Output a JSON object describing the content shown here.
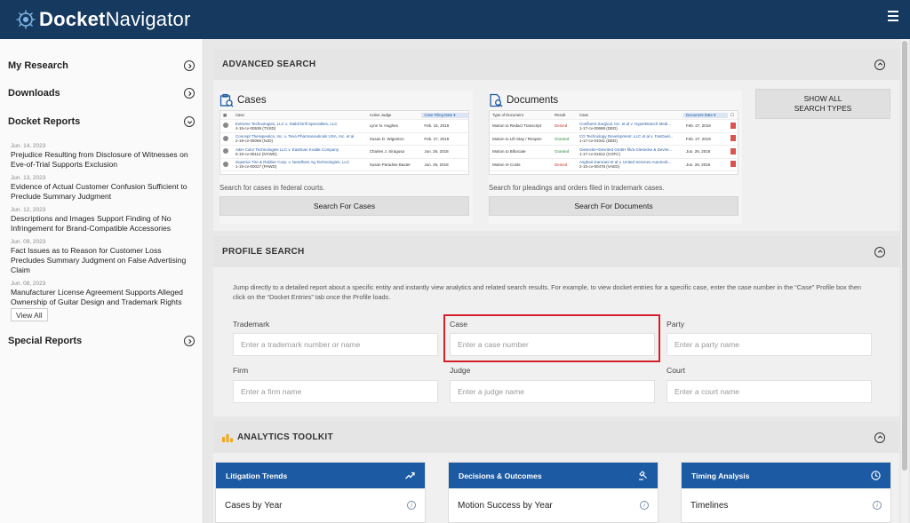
{
  "brand": {
    "bold": "Docket",
    "rest": "Navigator"
  },
  "sidebar": {
    "my_research": "My Research",
    "downloads": "Downloads",
    "docket_reports": "Docket Reports",
    "reports": [
      {
        "date": "Jun. 14, 2023",
        "title": "Prejudice Resulting from Disclosure of Witnesses on Eve-of-Trial Supports Exclusion"
      },
      {
        "date": "Jun. 13, 2023",
        "title": "Evidence of Actual Customer Confusion Sufficient to Preclude Summary Judgment"
      },
      {
        "date": "Jun. 12, 2023",
        "title": "Descriptions and Images Support Finding of No Infringement for Brand-Compatible Accessories"
      },
      {
        "date": "Jun. 09, 2023",
        "title": "Fact Issues as to Reason for Customer Loss Precludes Summary Judgment on False Advertising Claim"
      },
      {
        "date": "Jun. 08, 2023",
        "title": "Manufacturer License Agreement Supports Alleged Ownership of Guitar Design and Trademark Rights"
      }
    ],
    "view_all": "View All",
    "special_reports": "Special Reports"
  },
  "advanced": {
    "title": "ADVANCED SEARCH",
    "cases": {
      "title": "Cases",
      "columns": [
        "Case",
        "Active Judge",
        "Case Filing Date"
      ],
      "rows": [
        {
          "case": "Extreme Technologies, LLC v. Stabil Drill Specialties, LLC",
          "num": "4-15-cv-00539 (TXSD)",
          "judge": "Lynn N. Hughes",
          "date": "Feb. 15, 2018"
        },
        {
          "case": "Concept Therapeutics, Inc. v. Teva Pharmaceuticals USA, Inc. et al",
          "num": "2-19-cv-05068 (NJD)",
          "judge": "Susan D. Wigenton",
          "date": "Feb. 27, 2019"
        },
        {
          "case": "A&H Color Technologies LLC v. Eastman Kodak Company",
          "num": "6-19-cv-06112 (NYWD)",
          "judge": "Charles J. Siragusa",
          "date": "Jun. 26, 2018"
        },
        {
          "case": "Superior Tire & Rubber Corp. v. Needham Ag Technologies, LLC",
          "num": "1-19-cv-00027 (PAWD)",
          "judge": "Susan Paradise Baxter",
          "date": "Jun. 26, 2018"
        }
      ],
      "desc": "Search for cases in federal courts.",
      "button": "Search For Cases"
    },
    "documents": {
      "title": "Documents",
      "columns": [
        "Type of Document",
        "Result",
        "Case",
        "Document Date"
      ],
      "rows": [
        {
          "type": "Motion to Redact Transcript",
          "result": "Denied",
          "case": "Confluent Surgical, Inc. et al v. HyperBranch Medi...",
          "num": "1-17-cv-00688 (DED)",
          "date": "Feb. 27, 2019"
        },
        {
          "type": "Motion to Lift Stay / Reopen",
          "result": "Granted",
          "case": "CG Technology Development, LLC et al v. FanDuel...",
          "num": "1-17-cv-01041 (DED)",
          "date": "Feb. 27, 2019"
        },
        {
          "type": "Motion to Bifurcate",
          "result": "Granted",
          "case": "Giesecke+Devrient GmbH f/k/a Giesecke & Devrie...",
          "num": "1-17-cv-01812 (COFC)",
          "date": "Jun. 26, 2018"
        },
        {
          "type": "Motion re Costs",
          "result": "Denied",
          "case": "Asghari-Kamrani et al v. United Services Automob...",
          "num": "2-15-cv-00478 (VAED)",
          "date": "Jun. 26, 2018"
        }
      ],
      "desc": "Search for pleadings and orders filed in trademark cases.",
      "button": "Search For Documents"
    },
    "show_all": "SHOW ALL SEARCH TYPES"
  },
  "profile": {
    "title": "PROFILE SEARCH",
    "hint": "Jump directly to a detailed report about a specific entity and instantly view analytics and related search results. For example, to view docket entries for a specific case, enter the case number in the “Case” Profile box then click on the “Docket Entries” tab once the Profile loads.",
    "fields": {
      "trademark": {
        "label": "Trademark",
        "placeholder": "Enter a trademark number or name"
      },
      "case": {
        "label": "Case",
        "placeholder": "Enter a case number"
      },
      "party": {
        "label": "Party",
        "placeholder": "Enter a party name"
      },
      "firm": {
        "label": "Firm",
        "placeholder": "Enter a firm name"
      },
      "judge": {
        "label": "Judge",
        "placeholder": "Enter a judge name"
      },
      "court": {
        "label": "Court",
        "placeholder": "Enter a court name"
      }
    }
  },
  "analytics": {
    "title": "ANALYTICS TOOLKIT",
    "cards": [
      {
        "head": "Litigation Trends",
        "item": "Cases by Year"
      },
      {
        "head": "Decisions & Outcomes",
        "item": "Motion Success by Year"
      },
      {
        "head": "Timing Analysis",
        "item": "Timelines"
      }
    ]
  },
  "colors": {
    "header": "#163a5f",
    "card_head": "#1c5aa3",
    "highlight": "#d4202a"
  }
}
